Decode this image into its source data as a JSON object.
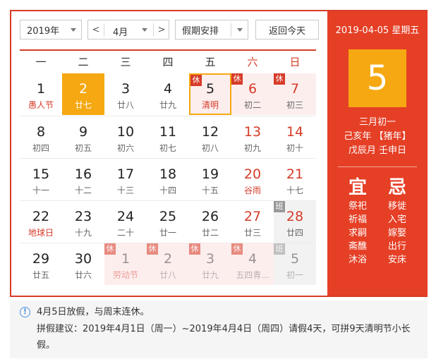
{
  "toolbar": {
    "year": "2019年",
    "prev": "<",
    "month": "4月",
    "next": ">",
    "holiday": "假期安排",
    "today": "返回今天"
  },
  "weekdays": [
    "一",
    "二",
    "三",
    "四",
    "五",
    "六",
    "日"
  ],
  "weeks": [
    [
      {
        "d": "1",
        "l": "愚人节"
      },
      {
        "d": "2",
        "l": "廿七"
      },
      {
        "d": "3",
        "l": "廿八"
      },
      {
        "d": "4",
        "l": "廿九"
      },
      {
        "d": "5",
        "l": "清明",
        "badge": "休"
      },
      {
        "d": "6",
        "l": "初二",
        "badge": "休"
      },
      {
        "d": "7",
        "l": "初三",
        "badge": "休"
      }
    ],
    [
      {
        "d": "8",
        "l": "初四"
      },
      {
        "d": "9",
        "l": "初五"
      },
      {
        "d": "10",
        "l": "初六"
      },
      {
        "d": "11",
        "l": "初七"
      },
      {
        "d": "12",
        "l": "初八"
      },
      {
        "d": "13",
        "l": "初九"
      },
      {
        "d": "14",
        "l": "初十"
      }
    ],
    [
      {
        "d": "15",
        "l": "十一"
      },
      {
        "d": "16",
        "l": "十二"
      },
      {
        "d": "17",
        "l": "十三"
      },
      {
        "d": "18",
        "l": "十四"
      },
      {
        "d": "19",
        "l": "十五"
      },
      {
        "d": "20",
        "l": "谷雨"
      },
      {
        "d": "21",
        "l": "十七"
      }
    ],
    [
      {
        "d": "22",
        "l": "地球日"
      },
      {
        "d": "23",
        "l": "十九"
      },
      {
        "d": "24",
        "l": "二十"
      },
      {
        "d": "25",
        "l": "廿一"
      },
      {
        "d": "26",
        "l": "廿二"
      },
      {
        "d": "27",
        "l": "廿三"
      },
      {
        "d": "28",
        "l": "廿四",
        "badge": "班"
      }
    ],
    [
      {
        "d": "29",
        "l": "廿五"
      },
      {
        "d": "30",
        "l": "廿六"
      },
      {
        "d": "1",
        "l": "劳动节",
        "badge": "休"
      },
      {
        "d": "2",
        "l": "廿八",
        "badge": "休"
      },
      {
        "d": "3",
        "l": "廿九",
        "badge": "休"
      },
      {
        "d": "4",
        "l": "五四青...",
        "badge": "休"
      },
      {
        "d": "5",
        "l": "初一",
        "badge": "班"
      }
    ]
  ],
  "side": {
    "date": "2019-04-05 星期五",
    "day": "5",
    "lunar": "三月初一",
    "ganzhi_year": "己亥年 【猪年】",
    "ganzhi_month_day": "戊辰月 壬申日",
    "yi_label": "宜",
    "ji_label": "忌",
    "yi": [
      "祭祀",
      "祈福",
      "求嗣",
      "斋醮",
      "沐浴"
    ],
    "ji": [
      "移徙",
      "入宅",
      "嫁娶",
      "出行",
      "安床"
    ]
  },
  "tip": {
    "line1": "4月5日放假，与周末连休。",
    "line2": "拼假建议：2019年4月1日（周一）~2019年4月4日（周四）请假4天，可拼9天清明节小长假。"
  }
}
